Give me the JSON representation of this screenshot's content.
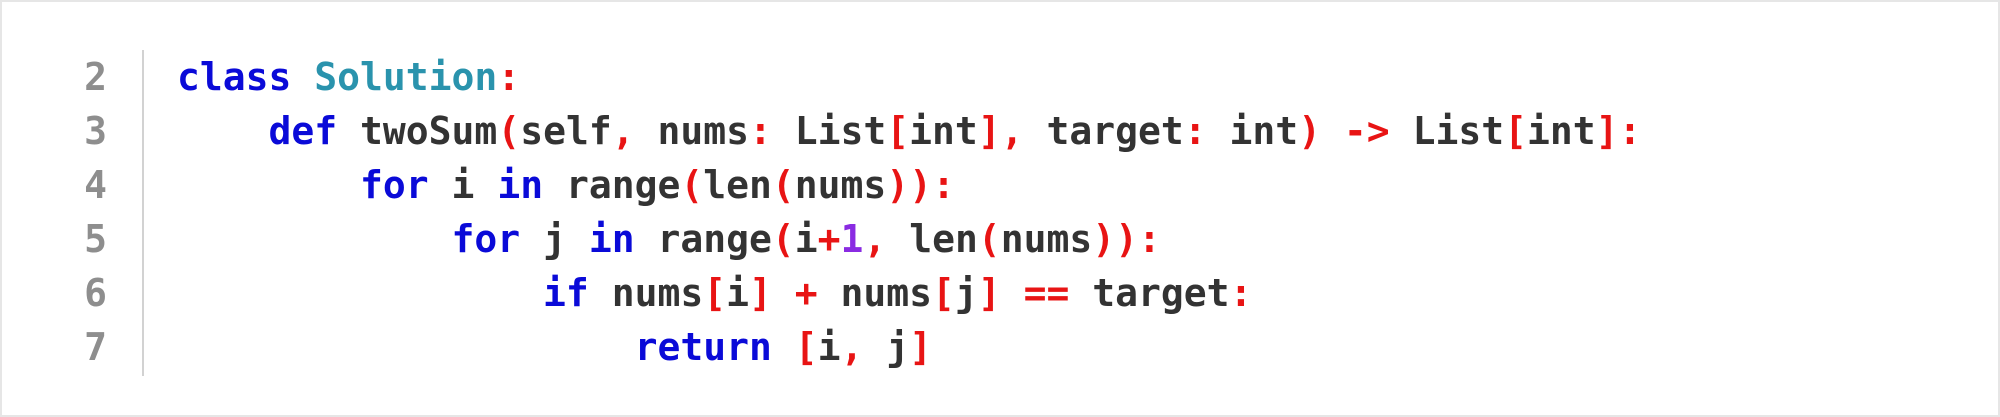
{
  "editor": {
    "line_numbers": [
      "2",
      "3",
      "4",
      "5",
      "6",
      "7"
    ],
    "lines": [
      {
        "number": "2",
        "tokens": [
          {
            "text": "class",
            "kind": "keyword"
          },
          {
            "text": " ",
            "kind": "space"
          },
          {
            "text": "Solution",
            "kind": "class_name"
          },
          {
            "text": ":",
            "kind": "punctuation"
          }
        ]
      },
      {
        "number": "3",
        "tokens": [
          {
            "text": "    ",
            "kind": "space"
          },
          {
            "text": "def",
            "kind": "keyword"
          },
          {
            "text": " twoSum",
            "kind": "name"
          },
          {
            "text": "(",
            "kind": "punctuation"
          },
          {
            "text": "self",
            "kind": "name"
          },
          {
            "text": ",",
            "kind": "punctuation"
          },
          {
            "text": " nums",
            "kind": "name"
          },
          {
            "text": ":",
            "kind": "punctuation"
          },
          {
            "text": " List",
            "kind": "name"
          },
          {
            "text": "[",
            "kind": "punctuation"
          },
          {
            "text": "int",
            "kind": "name"
          },
          {
            "text": "]",
            "kind": "punctuation"
          },
          {
            "text": ",",
            "kind": "punctuation"
          },
          {
            "text": " target",
            "kind": "name"
          },
          {
            "text": ":",
            "kind": "punctuation"
          },
          {
            "text": " int",
            "kind": "name"
          },
          {
            "text": ")",
            "kind": "punctuation"
          },
          {
            "text": " ->",
            "kind": "punctuation"
          },
          {
            "text": " List",
            "kind": "name"
          },
          {
            "text": "[",
            "kind": "punctuation"
          },
          {
            "text": "int",
            "kind": "name"
          },
          {
            "text": "]",
            "kind": "punctuation"
          },
          {
            "text": ":",
            "kind": "punctuation"
          }
        ]
      },
      {
        "number": "4",
        "tokens": [
          {
            "text": "        ",
            "kind": "space"
          },
          {
            "text": "for",
            "kind": "keyword"
          },
          {
            "text": " i ",
            "kind": "name"
          },
          {
            "text": "in",
            "kind": "keyword"
          },
          {
            "text": " range",
            "kind": "name"
          },
          {
            "text": "(",
            "kind": "punctuation"
          },
          {
            "text": "len",
            "kind": "name"
          },
          {
            "text": "(",
            "kind": "punctuation"
          },
          {
            "text": "nums",
            "kind": "name"
          },
          {
            "text": "))",
            "kind": "punctuation"
          },
          {
            "text": ":",
            "kind": "punctuation"
          }
        ]
      },
      {
        "number": "5",
        "tokens": [
          {
            "text": "            ",
            "kind": "space"
          },
          {
            "text": "for",
            "kind": "keyword"
          },
          {
            "text": " j ",
            "kind": "name"
          },
          {
            "text": "in",
            "kind": "keyword"
          },
          {
            "text": " range",
            "kind": "name"
          },
          {
            "text": "(",
            "kind": "punctuation"
          },
          {
            "text": "i",
            "kind": "name"
          },
          {
            "text": "+",
            "kind": "punctuation"
          },
          {
            "text": "1",
            "kind": "number"
          },
          {
            "text": ",",
            "kind": "punctuation"
          },
          {
            "text": " len",
            "kind": "name"
          },
          {
            "text": "(",
            "kind": "punctuation"
          },
          {
            "text": "nums",
            "kind": "name"
          },
          {
            "text": "))",
            "kind": "punctuation"
          },
          {
            "text": ":",
            "kind": "punctuation"
          }
        ]
      },
      {
        "number": "6",
        "tokens": [
          {
            "text": "                ",
            "kind": "space"
          },
          {
            "text": "if",
            "kind": "keyword"
          },
          {
            "text": " nums",
            "kind": "name"
          },
          {
            "text": "[",
            "kind": "punctuation"
          },
          {
            "text": "i",
            "kind": "name"
          },
          {
            "text": "]",
            "kind": "punctuation"
          },
          {
            "text": " +",
            "kind": "punctuation"
          },
          {
            "text": " nums",
            "kind": "name"
          },
          {
            "text": "[",
            "kind": "punctuation"
          },
          {
            "text": "j",
            "kind": "name"
          },
          {
            "text": "]",
            "kind": "punctuation"
          },
          {
            "text": " ==",
            "kind": "punctuation"
          },
          {
            "text": " target",
            "kind": "name"
          },
          {
            "text": ":",
            "kind": "punctuation"
          }
        ]
      },
      {
        "number": "7",
        "tokens": [
          {
            "text": "                    ",
            "kind": "space"
          },
          {
            "text": "return",
            "kind": "keyword"
          },
          {
            "text": " ",
            "kind": "space"
          },
          {
            "text": "[",
            "kind": "punctuation"
          },
          {
            "text": "i",
            "kind": "name"
          },
          {
            "text": ",",
            "kind": "punctuation"
          },
          {
            "text": " j",
            "kind": "name"
          },
          {
            "text": "]",
            "kind": "punctuation"
          }
        ]
      }
    ],
    "colors": {
      "keyword": "#0a0ad8",
      "class_name": "#2a93ad",
      "punctuation": "#e81414",
      "number": "#8a2be2",
      "name": "#333333",
      "line_number": "#8e8e8e",
      "gutter_border": "#d2d2d2",
      "background": "#ffffff"
    }
  }
}
